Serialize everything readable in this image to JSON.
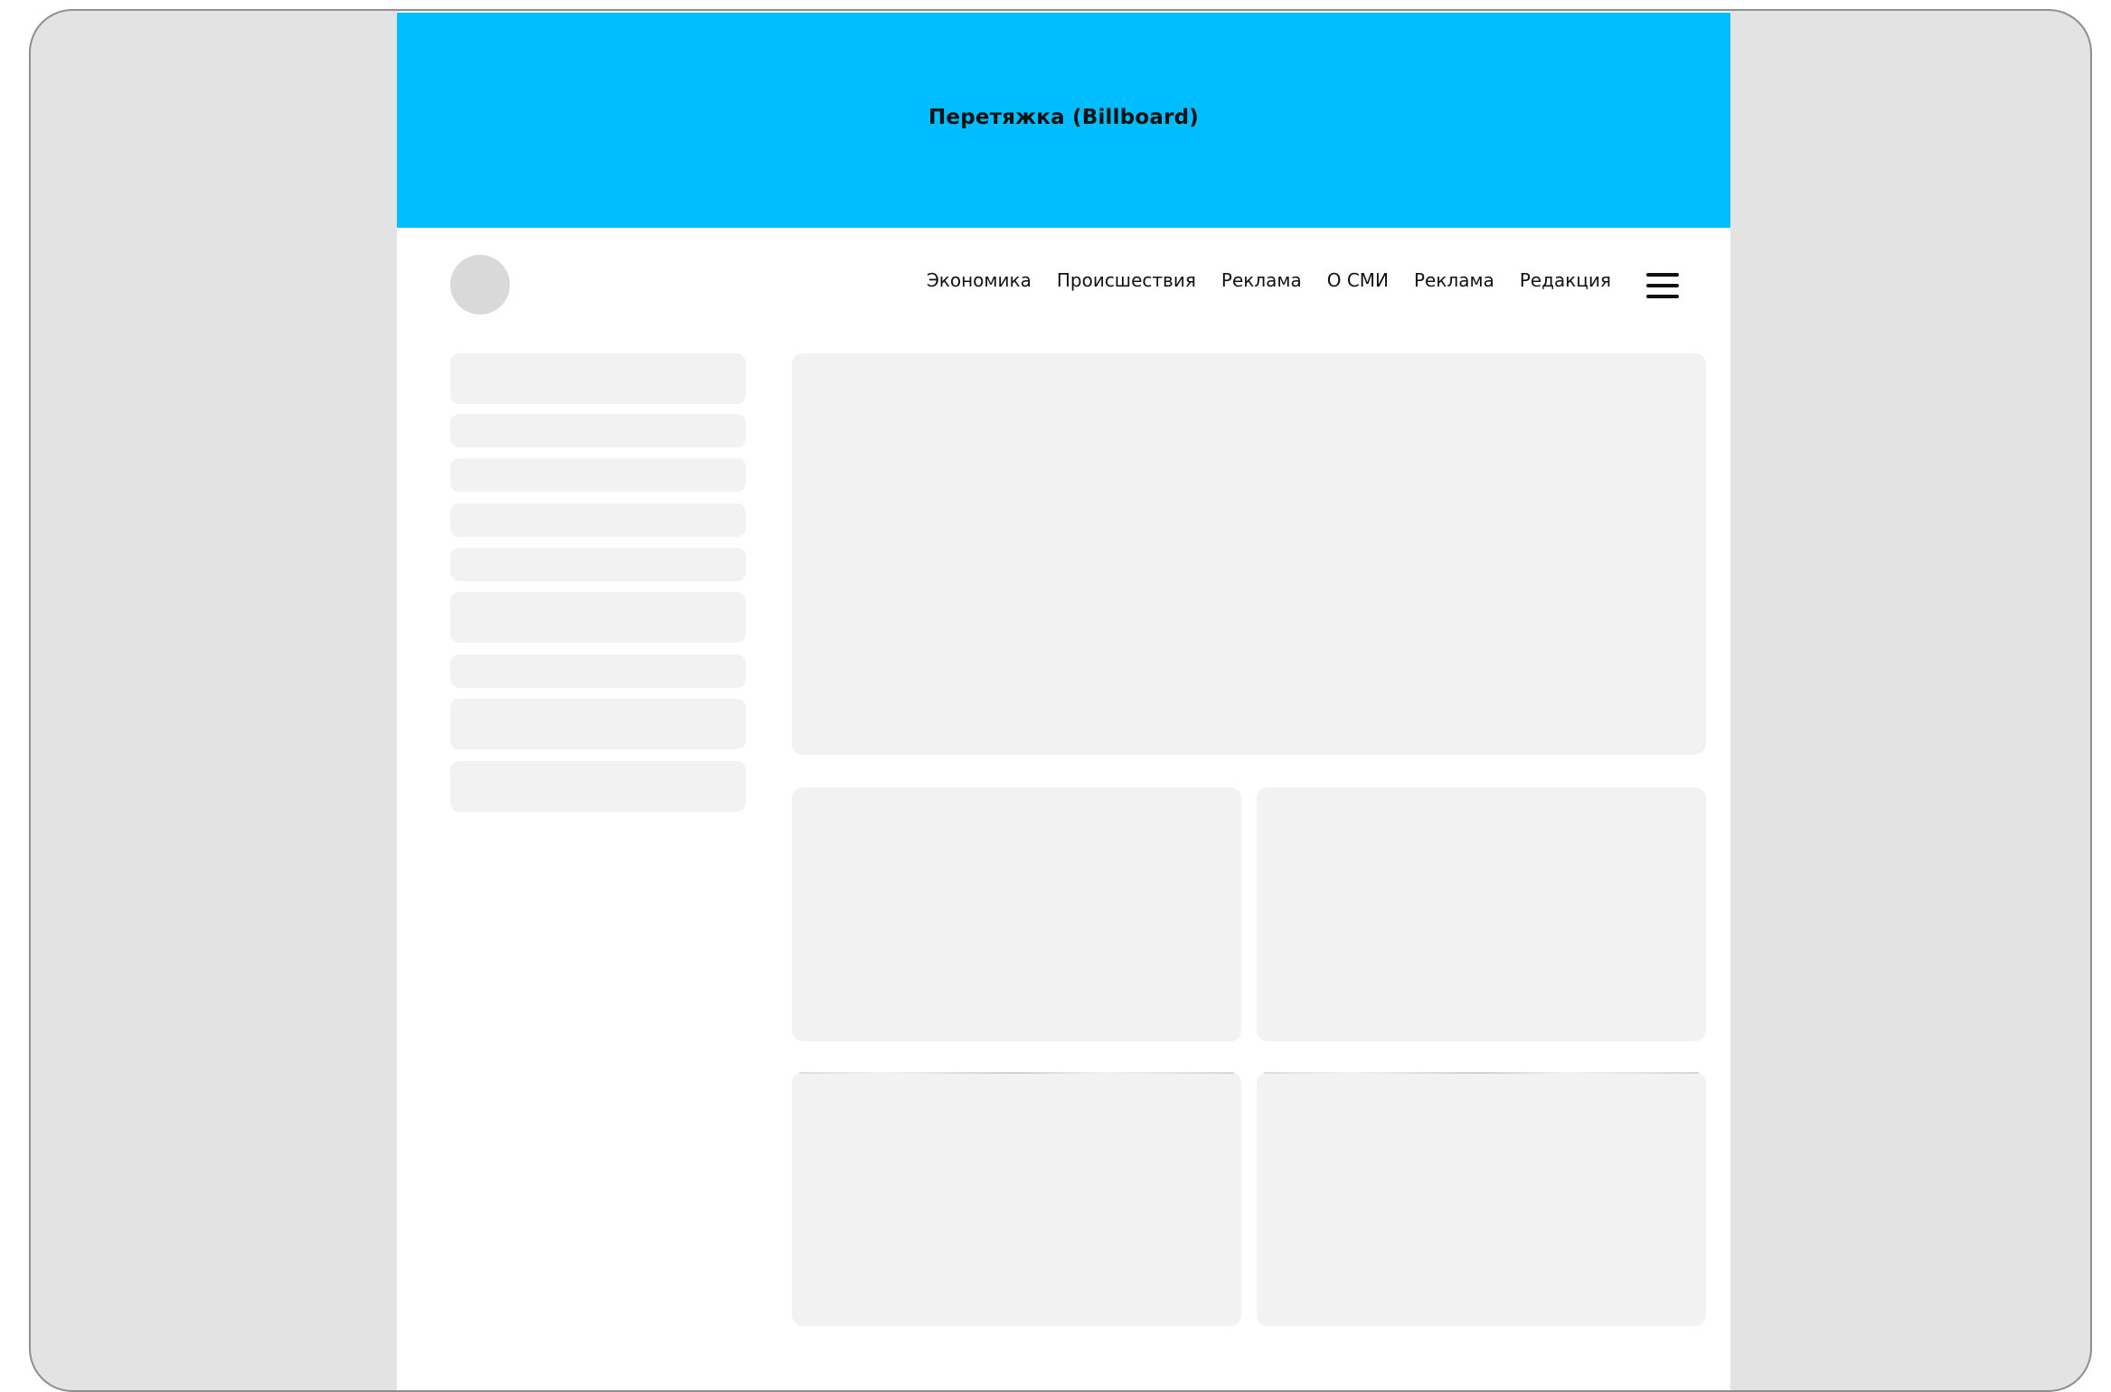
{
  "billboard": {
    "label": "Перетяжка (Billboard)",
    "color": "#00bdff"
  },
  "header": {
    "nav": [
      "Экономика",
      "Происшествия",
      "Реклама",
      "О СМИ",
      "Реклама",
      "Редакция"
    ],
    "menu_icon": "hamburger-menu-icon"
  },
  "colors": {
    "frame": "#e3e3e3",
    "skeleton": "#f2f2f2",
    "logo_placeholder": "#d9d9d9"
  }
}
